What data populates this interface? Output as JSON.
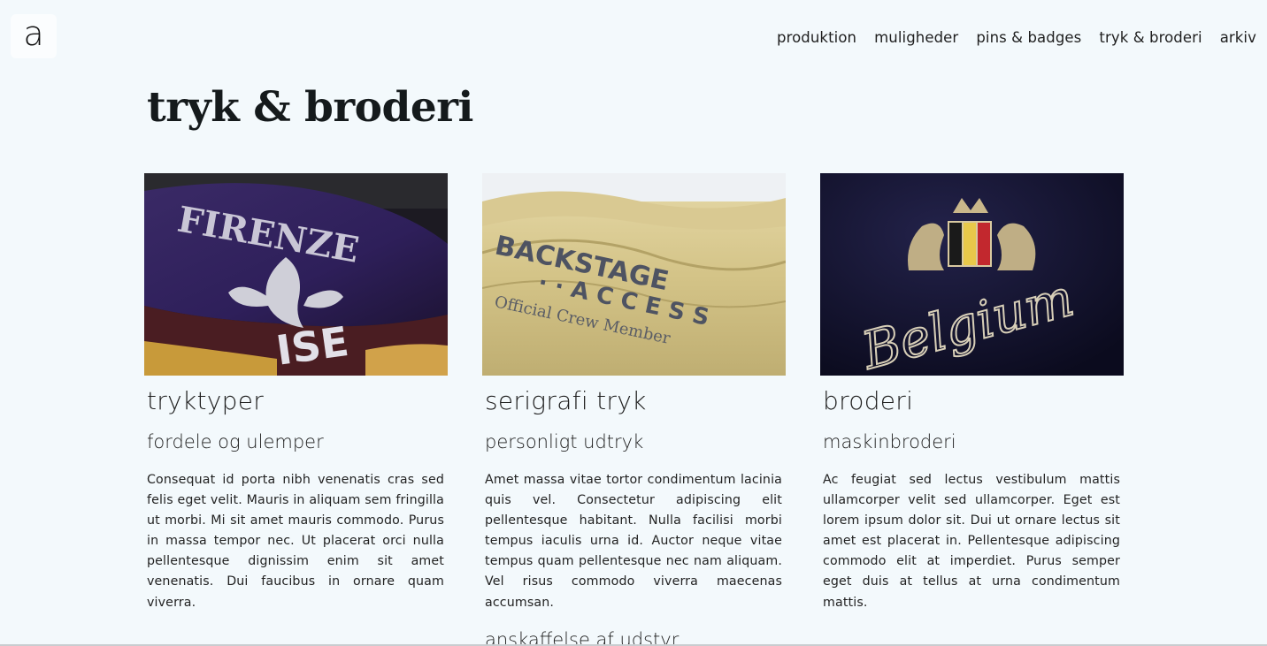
{
  "logo": {
    "letter": "a"
  },
  "nav": {
    "items": [
      "produktion",
      "muligheder",
      "pins & badges",
      "tryk & broderi",
      "arkiv"
    ]
  },
  "page": {
    "title": "tryk & broderi"
  },
  "cards": [
    {
      "image": "purple-firenze-shirt-photo",
      "title": "tryktyper",
      "subtitle": "fordele og ulemper",
      "body": "Consequat id porta nibh venenatis cras sed felis eget velit. Mauris in aliquam sem fringilla ut morbi. Mi sit amet mauris commodo. Purus in massa tempor nec. Ut placerat orci nulla pellentesque dignissim enim sit amet venenatis. Dui faucibus in ornare quam viverra."
    },
    {
      "image": "screenprint-shirt-photo",
      "title": "serigrafi tryk",
      "subtitle": "personligt udtryk",
      "body": "Amet massa vitae tortor condimentum lacinia quis vel. Consectetur adipiscing elit pellentesque habitant. Nulla facilisi morbi tempus iaculis urna id. Auctor neque vitae tempus quam pellentesque nec nam aliquam. Vel risus commodo viverra maecenas accumsan.",
      "next": "anskaffelse af udstyr"
    },
    {
      "image": "belgium-embroidery-photo",
      "title": "broderi",
      "subtitle": "maskinbroderi",
      "body": "Ac feugiat sed lectus vestibulum mattis ullamcorper velit sed ullamcorper. Eget est lorem ipsum dolor sit. Dui ut ornare lectus sit amet est placerat in. Pellentesque adipiscing commodo elit at imperdiet. Purus semper eget duis at tellus at urna condimentum mattis."
    }
  ],
  "colors": {
    "background": "#f3f9fc",
    "text": "#1d1d1d"
  }
}
